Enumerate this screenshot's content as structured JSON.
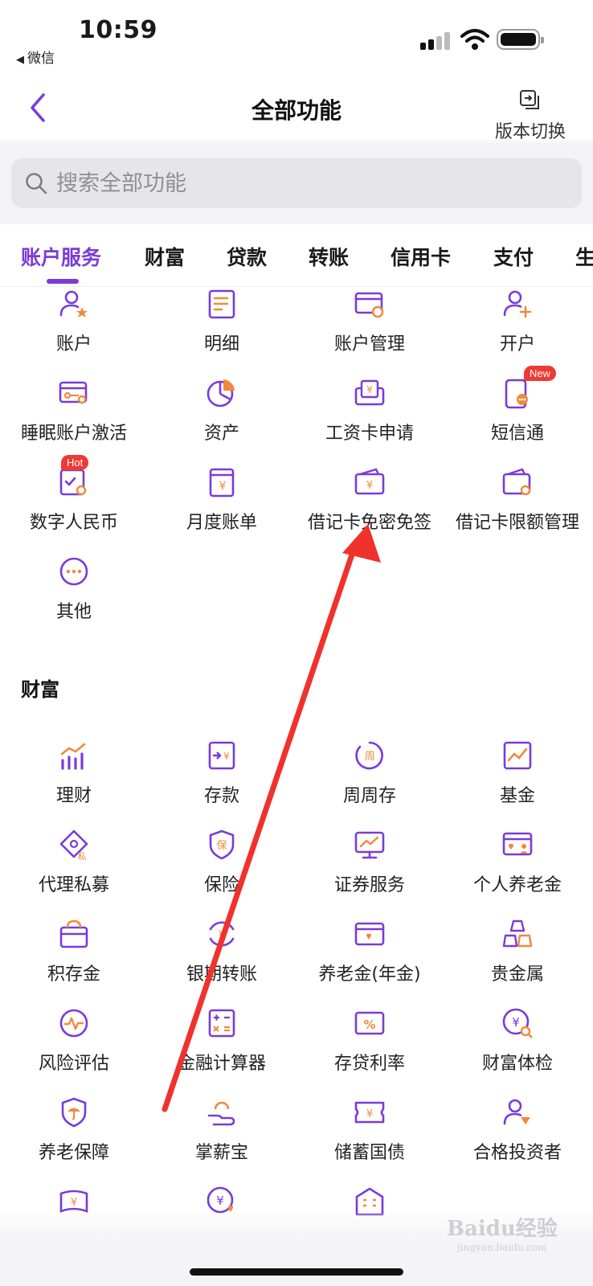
{
  "status_bar": {
    "time": "10:59",
    "back_app": "微信"
  },
  "navbar": {
    "title": "全部功能",
    "version_switch": "版本切换"
  },
  "search": {
    "placeholder": "搜索全部功能"
  },
  "tabs": [
    "账户服务",
    "财富",
    "贷款",
    "转账",
    "信用卡",
    "支付",
    "生"
  ],
  "account_section": {
    "items": [
      {
        "label": "账户",
        "icon": "user-star-icon"
      },
      {
        "label": "明细",
        "icon": "list-doc-icon"
      },
      {
        "label": "账户管理",
        "icon": "card-gear-icon"
      },
      {
        "label": "开户",
        "icon": "user-plus-icon"
      },
      {
        "label": "睡眠账户激活",
        "icon": "card-key-icon"
      },
      {
        "label": "资产",
        "icon": "pie-chart-icon"
      },
      {
        "label": "工资卡申请",
        "icon": "salary-card-icon"
      },
      {
        "label": "短信通",
        "icon": "sms-phone-icon",
        "badge": "New"
      },
      {
        "label": "数字人民币",
        "icon": "digital-rmb-icon",
        "badge": "Hot"
      },
      {
        "label": "月度账单",
        "icon": "bill-icon"
      },
      {
        "label": "借记卡免密免签",
        "icon": "wallet-yuan-icon"
      },
      {
        "label": "借记卡限额管理",
        "icon": "wallet-limit-icon"
      },
      {
        "label": "其他",
        "icon": "more-dots-icon"
      }
    ]
  },
  "wealth_section": {
    "title": "财富",
    "items": [
      {
        "label": "理财",
        "icon": "bar-trend-icon"
      },
      {
        "label": "存款",
        "icon": "deposit-icon"
      },
      {
        "label": "周周存",
        "icon": "weekly-icon"
      },
      {
        "label": "基金",
        "icon": "fund-chart-icon"
      },
      {
        "label": "代理私募",
        "icon": "private-fund-icon"
      },
      {
        "label": "保险",
        "icon": "insurance-shield-icon"
      },
      {
        "label": "证券服务",
        "icon": "securities-monitor-icon"
      },
      {
        "label": "个人养老金",
        "icon": "pension-card-icon"
      },
      {
        "label": "积存金",
        "icon": "gold-bag-icon"
      },
      {
        "label": "银期转账",
        "icon": "bank-futures-icon"
      },
      {
        "label": "养老金(年金)",
        "icon": "annuity-card-icon"
      },
      {
        "label": "贵金属",
        "icon": "gold-bars-icon"
      },
      {
        "label": "风险评估",
        "icon": "risk-pulse-icon"
      },
      {
        "label": "金融计算器",
        "icon": "calculator-icon"
      },
      {
        "label": "存贷利率",
        "icon": "interest-rate-icon"
      },
      {
        "label": "财富体检",
        "icon": "wealth-check-icon"
      },
      {
        "label": "养老保障",
        "icon": "umbrella-shield-icon"
      },
      {
        "label": "掌薪宝",
        "icon": "hand-coin-icon"
      },
      {
        "label": "储蓄国债",
        "icon": "bond-ticket-icon"
      },
      {
        "label": "合格投资者",
        "icon": "investor-user-icon"
      },
      {
        "label": "",
        "icon": "yuan-note-icon"
      },
      {
        "label": "",
        "icon": "yuan-heart-icon"
      },
      {
        "label": "",
        "icon": "building-icon"
      }
    ]
  },
  "watermark": {
    "brand": "Baidu经验",
    "site": "jingyan.baidu.com"
  },
  "colors": {
    "accent": "#7a3bd9",
    "icon_orange": "#f08a3c",
    "badge_red": "#ee3a32",
    "arrow": "#f0322c"
  }
}
